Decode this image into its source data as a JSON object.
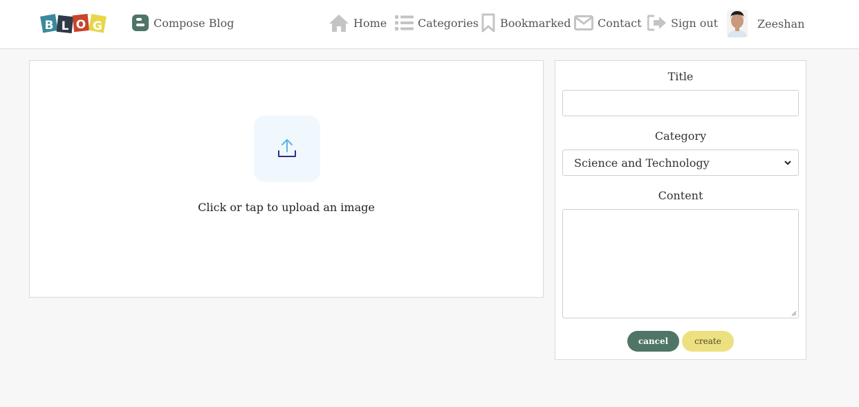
{
  "brand": {
    "logo_letters": [
      "B",
      "L",
      "O",
      "G"
    ],
    "colors": {
      "primary": "#4f7567",
      "accent": "#ede080",
      "background": "#f7f7f7"
    }
  },
  "nav": {
    "compose_label": "Compose Blog",
    "items": [
      {
        "label": "Home",
        "icon": "home-icon"
      },
      {
        "label": "Categories",
        "icon": "list-icon"
      },
      {
        "label": "Bookmarked",
        "icon": "bookmark-icon"
      },
      {
        "label": "Contact",
        "icon": "envelope-icon"
      },
      {
        "label": "Sign out",
        "icon": "sign-out-icon"
      }
    ],
    "user_name": "Zeeshan"
  },
  "upload": {
    "prompt": "Click or tap to upload an image",
    "icon": "upload-icon"
  },
  "form": {
    "title_label": "Title",
    "title_value": "",
    "category_label": "Category",
    "category_selected": "Science and Technology",
    "content_label": "Content",
    "content_value": "",
    "cancel_label": "cancel",
    "create_label": "create"
  }
}
